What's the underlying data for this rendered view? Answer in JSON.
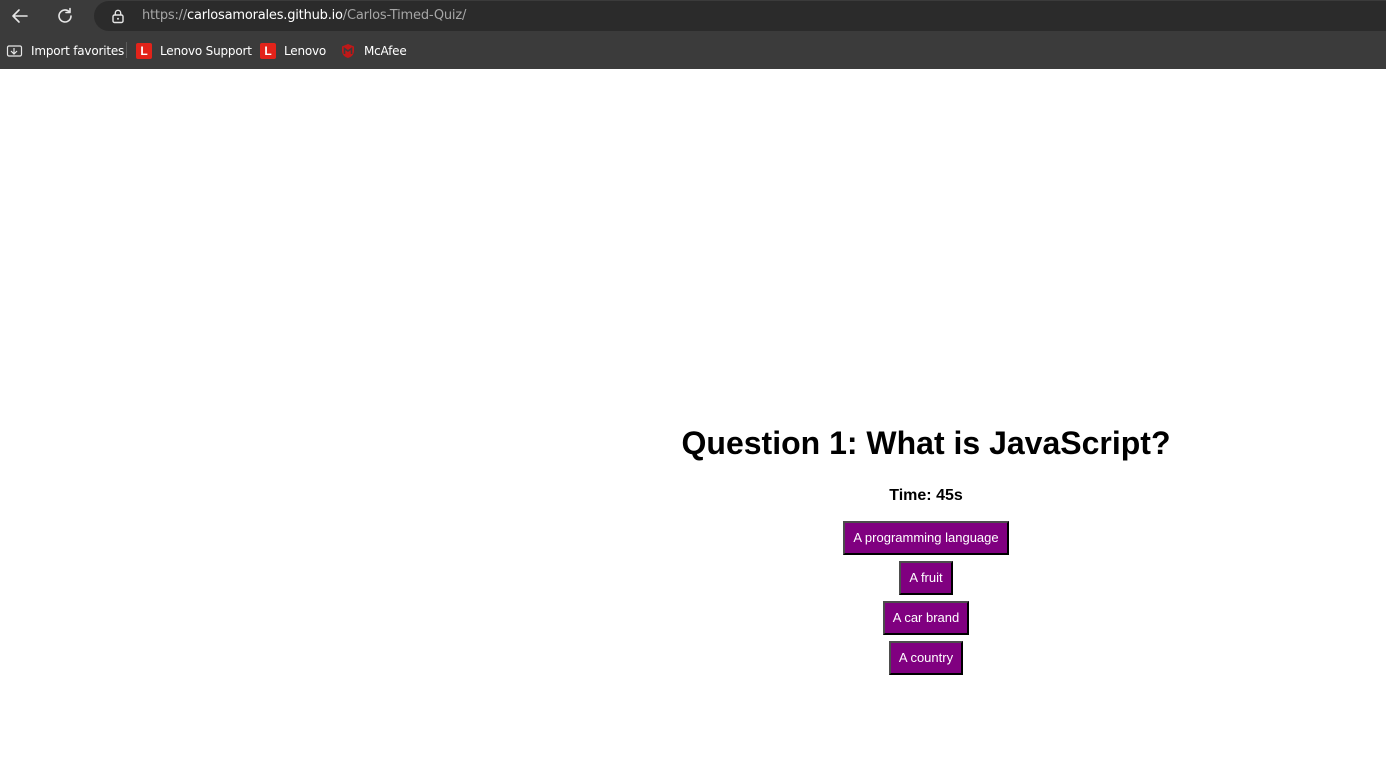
{
  "browser": {
    "url_scheme": "https://",
    "url_host": "carlosamorales.github.io",
    "url_path": "/Carlos-Timed-Quiz/",
    "bookmarks": [
      {
        "label": "Import favorites",
        "icon": "import-icon"
      },
      {
        "label": "Lenovo Support",
        "icon": "lenovo-logo-icon",
        "logo_letter": "L"
      },
      {
        "label": "Lenovo",
        "icon": "lenovo-logo-icon",
        "logo_letter": "L"
      },
      {
        "label": "McAfee",
        "icon": "mcafee-logo-icon"
      }
    ]
  },
  "quiz": {
    "question": "Question 1: What is JavaScript?",
    "timer": "Time: 45s",
    "answers": [
      "A programming language",
      "A fruit",
      "A car brand",
      "A country"
    ]
  },
  "colors": {
    "answer_button_bg": "#800080",
    "lenovo_red": "#e2231a",
    "mcafee_red": "#c01818"
  }
}
